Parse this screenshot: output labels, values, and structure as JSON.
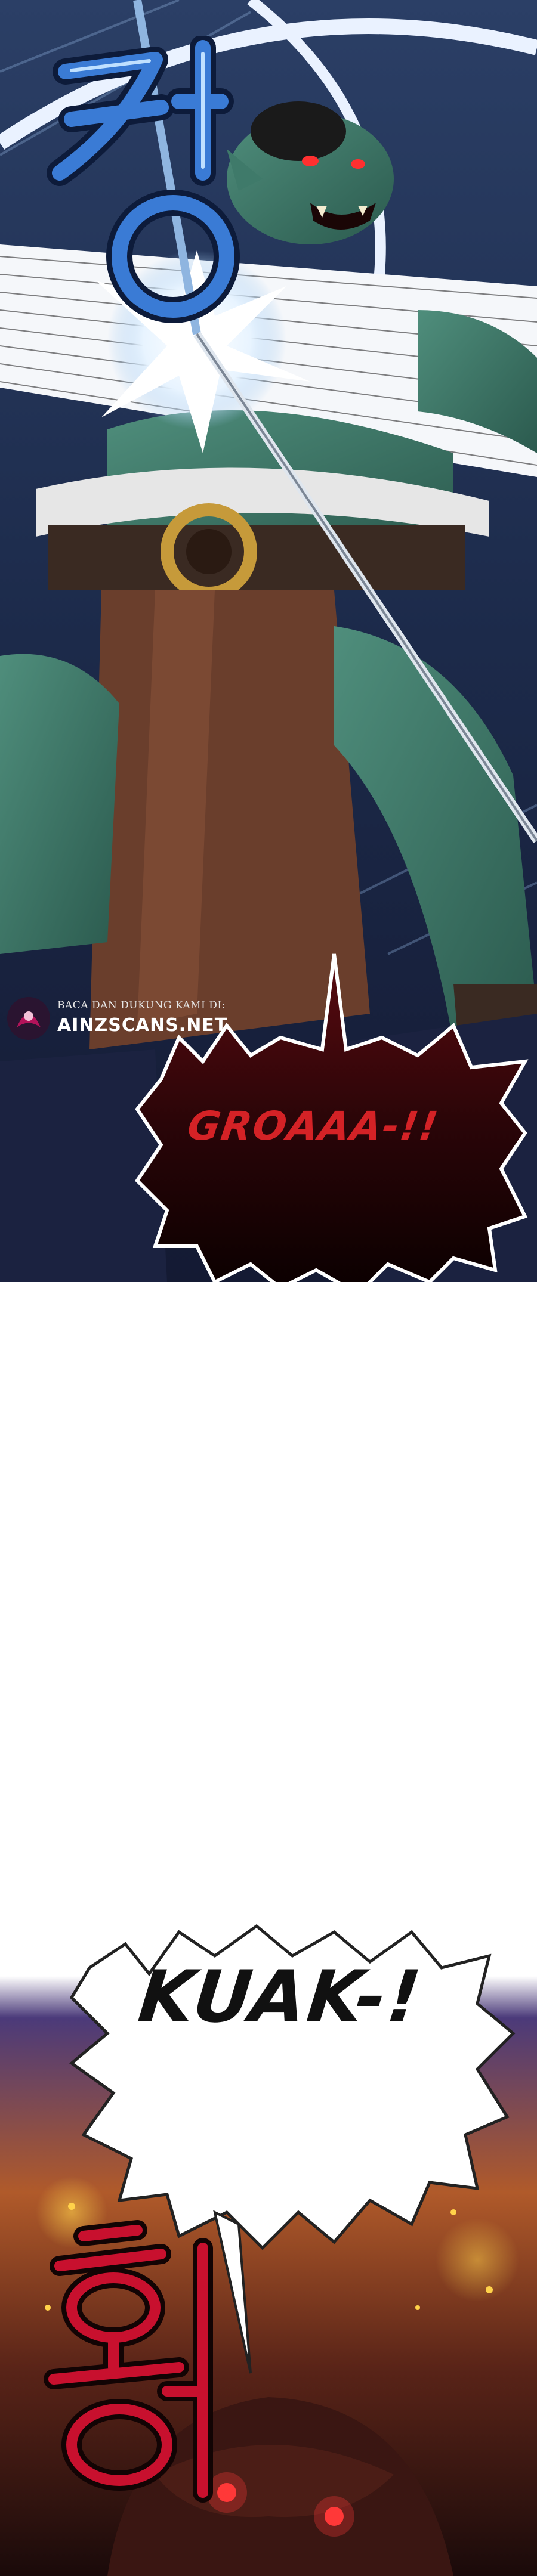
{
  "watermark": {
    "line1": "BACA DAN DUKUNG KAMI DI:",
    "line2": "AINZSCANS.NET"
  },
  "sfx": {
    "top_korean": "캉",
    "bottom_korean": "후아"
  },
  "speech": {
    "groaaa": "GROAAA-!!",
    "kuak": "KUAK-!"
  },
  "colors": {
    "night_blue": "#1c2a4a",
    "orc_skin": "#3f7a6a",
    "bubble_dark": "#2a0508",
    "bubble_red_text": "#d42226",
    "sfx_blue": "#3a7bd5",
    "sfx_red": "#c8102e",
    "fire_orange": "#e0701a"
  }
}
